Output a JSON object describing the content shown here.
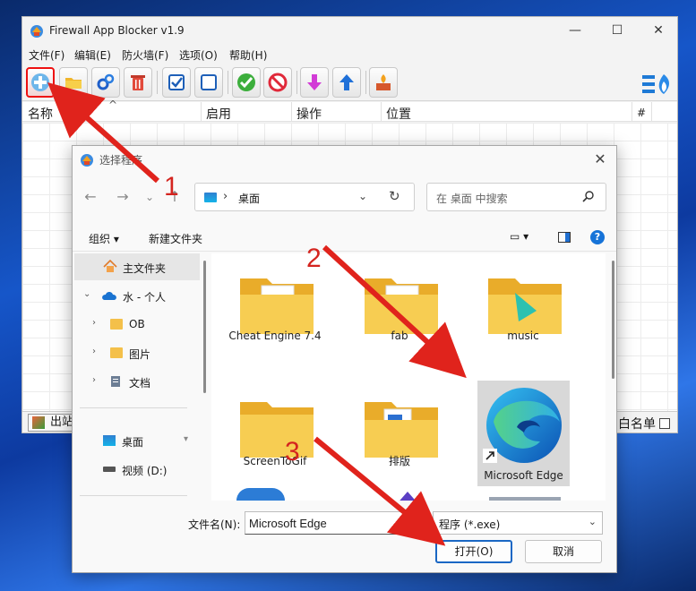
{
  "app": {
    "title": "Firewall App Blocker v1.9",
    "window_controls": {
      "minimize": "—",
      "maximize": "☐",
      "close": "✕"
    },
    "menu": [
      "文件(F)",
      "编辑(E)",
      "防火墙(F)",
      "选项(O)",
      "帮助(H)"
    ],
    "toolbar_icons": [
      "add-app-icon",
      "add-folder-icon",
      "settings-icon",
      "delete-icon",
      "check-all-icon",
      "uncheck-all-icon",
      "enable-icon",
      "disable-icon",
      "move-down-icon",
      "move-up-icon",
      "firewall-icon",
      "windows-firewall-icon"
    ],
    "columns": [
      "名称",
      "启用",
      "操作",
      "位置",
      "#"
    ],
    "sort_indicator": "^",
    "status": {
      "exit_label": "出站",
      "whitelist_label": "白名单"
    }
  },
  "dialog": {
    "title": "选择程序",
    "close": "✕",
    "nav_buttons": {
      "back": "←",
      "forward": "→",
      "recent": "⌄",
      "up": "↑"
    },
    "address": {
      "separator": "›",
      "current": "桌面",
      "dropdown": "⌄",
      "refresh": "↻"
    },
    "search_placeholder": "在 桌面 中搜索",
    "commands": {
      "organize": "组织 ▾",
      "new_folder": "新建文件夹",
      "view": "▭ ▾",
      "help": "?"
    },
    "nav_pane": [
      {
        "label": "主文件夹",
        "icon": "home-icon",
        "selected": true
      },
      {
        "label": "水 - 个人",
        "icon": "cloud-icon",
        "chevron": "⌄"
      },
      {
        "label": "OB",
        "icon": "folder-icon",
        "chevron": "›"
      },
      {
        "label": "图片",
        "icon": "folder-icon",
        "chevron": "›"
      },
      {
        "label": "文档",
        "icon": "document-icon",
        "chevron": "›"
      },
      {
        "label": "桌面",
        "icon": "desktop-icon",
        "pin": "📌"
      },
      {
        "label": "视频 (D:)",
        "icon": "drive-icon"
      }
    ],
    "files": [
      {
        "name": "Cheat Engine 7.4",
        "type": "folder"
      },
      {
        "name": "fab",
        "type": "folder"
      },
      {
        "name": "music",
        "type": "folder"
      },
      {
        "name": "ScreenToGif",
        "type": "folder"
      },
      {
        "name": "排版",
        "type": "folder"
      },
      {
        "name": "Microsoft Edge",
        "type": "shortcut",
        "selected": true
      }
    ],
    "filename_label": "文件名(N):",
    "filename_value": "Microsoft Edge",
    "filetype": "程序 (*.exe)",
    "filetype_chevron": "⌄",
    "open_button": "打开(O)",
    "cancel_button": "取消"
  },
  "annotations": {
    "step1": "1",
    "step2": "2",
    "step3": "3"
  },
  "colors": {
    "annotation": "#d4241f",
    "accent": "#1a67c4"
  }
}
